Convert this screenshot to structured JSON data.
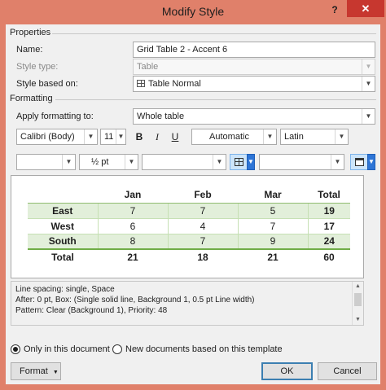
{
  "window": {
    "title": "Modify Style",
    "help_label": "?",
    "close_label": "✕"
  },
  "properties": {
    "section_title": "Properties",
    "name_label": "Name:",
    "name_value": "Grid Table 2 - Accent 6",
    "style_type_label": "Style type:",
    "style_type_value": "Table",
    "based_on_label": "Style based on:",
    "based_on_value": "Table Normal"
  },
  "formatting": {
    "section_title": "Formatting",
    "apply_label": "Apply formatting to:",
    "apply_value": "Whole table",
    "font": "Calibri (Body)",
    "size": "11",
    "bold": "B",
    "italic": "I",
    "underline": "U",
    "color": "Automatic",
    "script": "Latin",
    "line_style": "",
    "line_weight": "½ pt",
    "line_color": "",
    "shading": "",
    "accent_color": "#70ad47"
  },
  "preview": {
    "columns": [
      "",
      "Jan",
      "Feb",
      "Mar",
      "Total"
    ],
    "rows": [
      {
        "label": "East",
        "values": [
          "7",
          "7",
          "5"
        ],
        "total": "19"
      },
      {
        "label": "West",
        "values": [
          "6",
          "4",
          "7"
        ],
        "total": "17"
      },
      {
        "label": "South",
        "values": [
          "8",
          "7",
          "9"
        ],
        "total": "24"
      }
    ],
    "total_row": {
      "label": "Total",
      "values": [
        "21",
        "18",
        "21"
      ],
      "total": "60"
    }
  },
  "description": {
    "line1": "Line spacing:  single, Space",
    "line2": "After:  0 pt, Box: (Single solid line, Background 1,  0.5 pt Line width)",
    "line3": "Pattern: Clear (Background 1), Priority: 48"
  },
  "scope": {
    "only_document": "Only in this document",
    "new_documents": "New documents based on this template"
  },
  "buttons": {
    "format": "Format",
    "ok": "OK",
    "cancel": "Cancel"
  }
}
